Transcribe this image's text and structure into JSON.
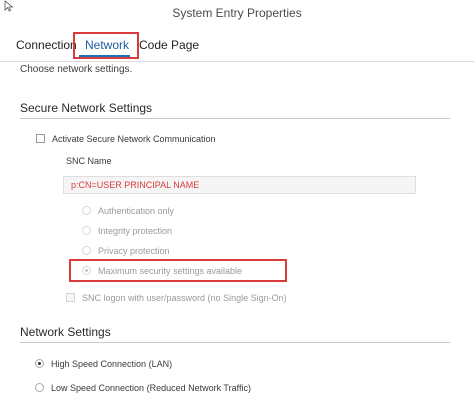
{
  "window": {
    "title": "System Entry Properties"
  },
  "tabs": [
    {
      "label": "Connection"
    },
    {
      "label": "Network"
    },
    {
      "label": "Code Page"
    }
  ],
  "active_tab": "Network",
  "subtitle": "Choose network settings.",
  "secure_section": {
    "title": "Secure Network Settings",
    "activate_label": "Activate Secure Network Communication",
    "snc_name_label": "SNC Name",
    "snc_name_value": "p:CN=USER PRINCIPAL NAME",
    "options": [
      {
        "label": "Authentication only"
      },
      {
        "label": "Integrity protection"
      },
      {
        "label": "Privacy protection"
      },
      {
        "label": "Maximum security settings available"
      }
    ],
    "snc_logon_label": "SNC logon with user/password (no Single Sign-On)"
  },
  "network_section": {
    "title": "Network Settings",
    "options": [
      {
        "label": "High Speed Connection (LAN)"
      },
      {
        "label": "Low Speed Connection (Reduced Network Traffic)"
      }
    ]
  },
  "colors": {
    "highlight": "#d83b3b",
    "tab_active": "#1a5d9b",
    "accent_underline": "#1a73b8"
  }
}
